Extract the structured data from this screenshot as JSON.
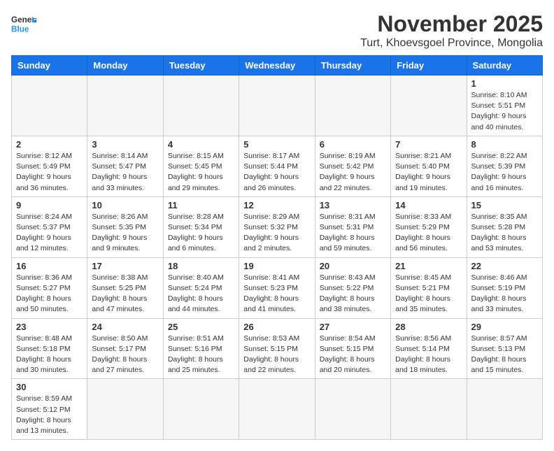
{
  "header": {
    "logo_general": "General",
    "logo_blue": "Blue",
    "main_title": "November 2025",
    "subtitle": "Turt, Khoevsgoel Province, Mongolia"
  },
  "weekdays": [
    "Sunday",
    "Monday",
    "Tuesday",
    "Wednesday",
    "Thursday",
    "Friday",
    "Saturday"
  ],
  "days": [
    {
      "date": "",
      "info": ""
    },
    {
      "date": "",
      "info": ""
    },
    {
      "date": "",
      "info": ""
    },
    {
      "date": "",
      "info": ""
    },
    {
      "date": "",
      "info": ""
    },
    {
      "date": "",
      "info": ""
    },
    {
      "date": "1",
      "sunrise": "Sunrise: 8:10 AM",
      "sunset": "Sunset: 5:51 PM",
      "daylight": "Daylight: 9 hours and 40 minutes."
    },
    {
      "date": "2",
      "sunrise": "Sunrise: 8:12 AM",
      "sunset": "Sunset: 5:49 PM",
      "daylight": "Daylight: 9 hours and 36 minutes."
    },
    {
      "date": "3",
      "sunrise": "Sunrise: 8:14 AM",
      "sunset": "Sunset: 5:47 PM",
      "daylight": "Daylight: 9 hours and 33 minutes."
    },
    {
      "date": "4",
      "sunrise": "Sunrise: 8:15 AM",
      "sunset": "Sunset: 5:45 PM",
      "daylight": "Daylight: 9 hours and 29 minutes."
    },
    {
      "date": "5",
      "sunrise": "Sunrise: 8:17 AM",
      "sunset": "Sunset: 5:44 PM",
      "daylight": "Daylight: 9 hours and 26 minutes."
    },
    {
      "date": "6",
      "sunrise": "Sunrise: 8:19 AM",
      "sunset": "Sunset: 5:42 PM",
      "daylight": "Daylight: 9 hours and 22 minutes."
    },
    {
      "date": "7",
      "sunrise": "Sunrise: 8:21 AM",
      "sunset": "Sunset: 5:40 PM",
      "daylight": "Daylight: 9 hours and 19 minutes."
    },
    {
      "date": "8",
      "sunrise": "Sunrise: 8:22 AM",
      "sunset": "Sunset: 5:39 PM",
      "daylight": "Daylight: 9 hours and 16 minutes."
    },
    {
      "date": "9",
      "sunrise": "Sunrise: 8:24 AM",
      "sunset": "Sunset: 5:37 PM",
      "daylight": "Daylight: 9 hours and 12 minutes."
    },
    {
      "date": "10",
      "sunrise": "Sunrise: 8:26 AM",
      "sunset": "Sunset: 5:35 PM",
      "daylight": "Daylight: 9 hours and 9 minutes."
    },
    {
      "date": "11",
      "sunrise": "Sunrise: 8:28 AM",
      "sunset": "Sunset: 5:34 PM",
      "daylight": "Daylight: 9 hours and 6 minutes."
    },
    {
      "date": "12",
      "sunrise": "Sunrise: 8:29 AM",
      "sunset": "Sunset: 5:32 PM",
      "daylight": "Daylight: 9 hours and 2 minutes."
    },
    {
      "date": "13",
      "sunrise": "Sunrise: 8:31 AM",
      "sunset": "Sunset: 5:31 PM",
      "daylight": "Daylight: 8 hours and 59 minutes."
    },
    {
      "date": "14",
      "sunrise": "Sunrise: 8:33 AM",
      "sunset": "Sunset: 5:29 PM",
      "daylight": "Daylight: 8 hours and 56 minutes."
    },
    {
      "date": "15",
      "sunrise": "Sunrise: 8:35 AM",
      "sunset": "Sunset: 5:28 PM",
      "daylight": "Daylight: 8 hours and 53 minutes."
    },
    {
      "date": "16",
      "sunrise": "Sunrise: 8:36 AM",
      "sunset": "Sunset: 5:27 PM",
      "daylight": "Daylight: 8 hours and 50 minutes."
    },
    {
      "date": "17",
      "sunrise": "Sunrise: 8:38 AM",
      "sunset": "Sunset: 5:25 PM",
      "daylight": "Daylight: 8 hours and 47 minutes."
    },
    {
      "date": "18",
      "sunrise": "Sunrise: 8:40 AM",
      "sunset": "Sunset: 5:24 PM",
      "daylight": "Daylight: 8 hours and 44 minutes."
    },
    {
      "date": "19",
      "sunrise": "Sunrise: 8:41 AM",
      "sunset": "Sunset: 5:23 PM",
      "daylight": "Daylight: 8 hours and 41 minutes."
    },
    {
      "date": "20",
      "sunrise": "Sunrise: 8:43 AM",
      "sunset": "Sunset: 5:22 PM",
      "daylight": "Daylight: 8 hours and 38 minutes."
    },
    {
      "date": "21",
      "sunrise": "Sunrise: 8:45 AM",
      "sunset": "Sunset: 5:21 PM",
      "daylight": "Daylight: 8 hours and 35 minutes."
    },
    {
      "date": "22",
      "sunrise": "Sunrise: 8:46 AM",
      "sunset": "Sunset: 5:19 PM",
      "daylight": "Daylight: 8 hours and 33 minutes."
    },
    {
      "date": "23",
      "sunrise": "Sunrise: 8:48 AM",
      "sunset": "Sunset: 5:18 PM",
      "daylight": "Daylight: 8 hours and 30 minutes."
    },
    {
      "date": "24",
      "sunrise": "Sunrise: 8:50 AM",
      "sunset": "Sunset: 5:17 PM",
      "daylight": "Daylight: 8 hours and 27 minutes."
    },
    {
      "date": "25",
      "sunrise": "Sunrise: 8:51 AM",
      "sunset": "Sunset: 5:16 PM",
      "daylight": "Daylight: 8 hours and 25 minutes."
    },
    {
      "date": "26",
      "sunrise": "Sunrise: 8:53 AM",
      "sunset": "Sunset: 5:15 PM",
      "daylight": "Daylight: 8 hours and 22 minutes."
    },
    {
      "date": "27",
      "sunrise": "Sunrise: 8:54 AM",
      "sunset": "Sunset: 5:15 PM",
      "daylight": "Daylight: 8 hours and 20 minutes."
    },
    {
      "date": "28",
      "sunrise": "Sunrise: 8:56 AM",
      "sunset": "Sunset: 5:14 PM",
      "daylight": "Daylight: 8 hours and 18 minutes."
    },
    {
      "date": "29",
      "sunrise": "Sunrise: 8:57 AM",
      "sunset": "Sunset: 5:13 PM",
      "daylight": "Daylight: 8 hours and 15 minutes."
    },
    {
      "date": "30",
      "sunrise": "Sunrise: 8:59 AM",
      "sunset": "Sunset: 5:12 PM",
      "daylight": "Daylight: 8 hours and 13 minutes."
    }
  ]
}
